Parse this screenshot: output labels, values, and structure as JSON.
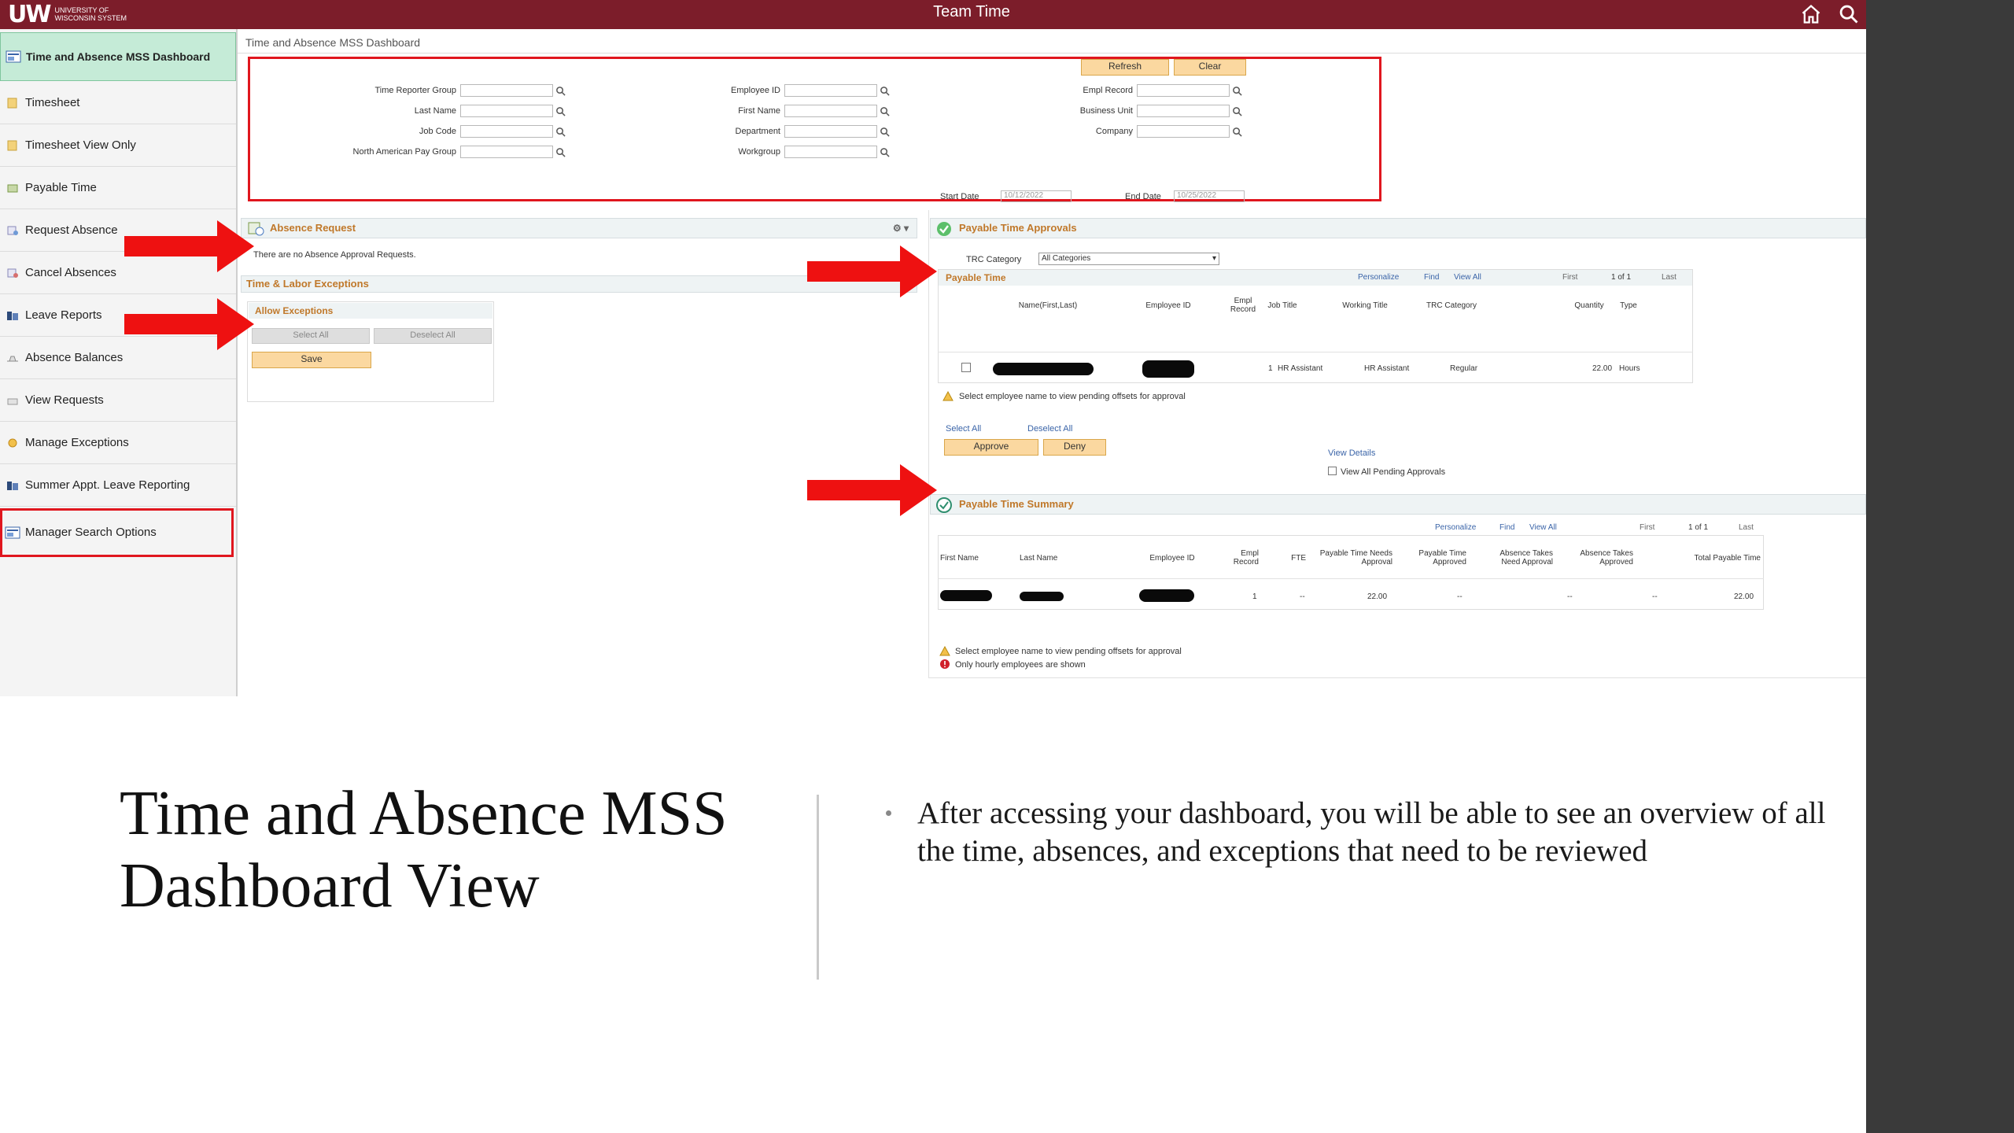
{
  "header": {
    "logo_mark": "UW",
    "logo_text_1": "UNIVERSITY OF",
    "logo_text_2": "WISCONSIN SYSTEM",
    "title": "Team Time",
    "icons": [
      "home-icon",
      "search-icon"
    ]
  },
  "sidebar": {
    "items": [
      {
        "label": "Time and Absence MSS Dashboard",
        "icon": "dashboard-icon"
      },
      {
        "label": "Timesheet",
        "icon": "timesheet-icon"
      },
      {
        "label": "Timesheet View Only",
        "icon": "timesheet-icon"
      },
      {
        "label": "Payable Time",
        "icon": "payable-time-icon"
      },
      {
        "label": "Request Absence",
        "icon": "request-absence-icon"
      },
      {
        "label": "Cancel Absences",
        "icon": "cancel-absence-icon"
      },
      {
        "label": "Leave Reports",
        "icon": "report-icon"
      },
      {
        "label": "Absence Balances",
        "icon": "balance-icon"
      },
      {
        "label": "View Requests",
        "icon": "requests-icon"
      },
      {
        "label": "Manage Exceptions",
        "icon": "exceptions-icon"
      },
      {
        "label": "Summer Appt. Leave Reporting",
        "icon": "report-icon"
      },
      {
        "label": "Manager Search Options",
        "icon": "search-options-icon"
      }
    ]
  },
  "content": {
    "breadcrumb": "Time and Absence MSS Dashboard",
    "search": {
      "refresh_label": "Refresh",
      "clear_label": "Clear",
      "fields": {
        "time_reporter_group": "Time Reporter Group",
        "last_name": "Last Name",
        "job_code": "Job Code",
        "na_pay_group": "North American Pay Group",
        "employee_id": "Employee ID",
        "first_name": "First Name",
        "department": "Department",
        "workgroup": "Workgroup",
        "empl_record": "Empl Record",
        "business_unit": "Business Unit",
        "company": "Company"
      },
      "start_date_label": "Start Date",
      "start_date_value": "10/12/2022",
      "end_date_label": "End Date",
      "end_date_value": "10/25/2022"
    },
    "absence_request": {
      "title": "Absence Request",
      "message": "There are no Absence Approval Requests."
    },
    "exceptions": {
      "title": "Time & Labor Exceptions",
      "sub_title": "Allow Exceptions",
      "select_all": "Select All",
      "deselect_all": "Deselect All",
      "save": "Save"
    },
    "payable_approvals": {
      "title": "Payable Time Approvals",
      "trc_label": "TRC Category",
      "trc_value": "All Categories",
      "grid_title": "Payable Time",
      "toolbar": {
        "personalize": "Personalize",
        "find": "Find",
        "view_all": "View All",
        "first": "First",
        "count": "1 of 1",
        "last": "Last"
      },
      "columns": [
        "Name(First,Last)",
        "Employee ID",
        "Empl Record",
        "Job Title",
        "Working Title",
        "TRC Category",
        "Quantity",
        "Type"
      ],
      "row": {
        "empl_record": "1",
        "job_title": "HR Assistant",
        "working_title": "HR Assistant",
        "trc_category": "Regular",
        "quantity": "22.00",
        "type": "Hours"
      },
      "note": "Select employee name to view pending offsets for approval",
      "select_all": "Select All",
      "deselect_all": "Deselect All",
      "approve": "Approve",
      "deny": "Deny",
      "view_details": "View Details",
      "view_all_pending": "View All Pending Approvals"
    },
    "payable_summary": {
      "title": "Payable Time Summary",
      "toolbar": {
        "personalize": "Personalize",
        "find": "Find",
        "view_all": "View All",
        "first": "First",
        "count": "1 of 1",
        "last": "Last"
      },
      "columns": [
        "First Name",
        "Last Name",
        "Employee ID",
        "Empl Record",
        "FTE",
        "Payable Time Needs Approval",
        "Payable Time Approved",
        "Absence Takes Need Approval",
        "Absence Takes Approved",
        "Total Payable Time"
      ],
      "row": {
        "empl_record": "1",
        "fte": "--",
        "needs_approval": "22.00",
        "approved": "--",
        "abs_need": "--",
        "abs_approved": "--",
        "total": "22.00"
      },
      "note1": "Select employee name to view pending offsets for approval",
      "note2": "Only hourly employees are shown"
    }
  },
  "slide": {
    "title": "Time and Absence MSS Dashboard View",
    "bullet": "After accessing your dashboard, you will be able to see an overview of all the time, absences, and exceptions that need to be reviewed"
  },
  "colors": {
    "header_bg": "#7c1d2a",
    "active_nav_bg": "#c5ebd7",
    "highlight_red": "#e0161e",
    "button_bg": "#fbd8a0",
    "panel_title": "#c0782a"
  }
}
